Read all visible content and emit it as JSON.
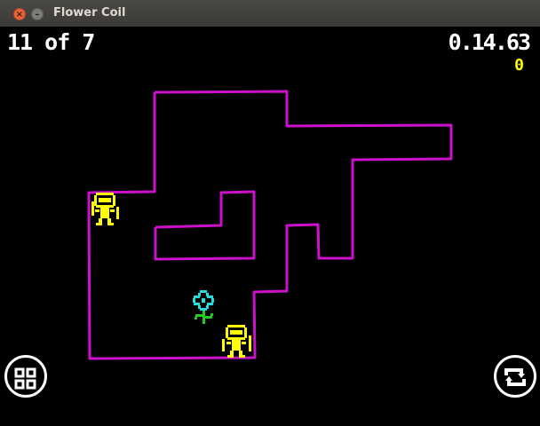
{
  "window": {
    "title": "Flower Coil"
  },
  "hud": {
    "level": "11 of 7",
    "timer": "0.14.63",
    "score": "0"
  },
  "colors": {
    "maze_wall": "#cc11cc",
    "player": "#ffff00",
    "flower_petals": "#22dddd",
    "flower_stem": "#22cc22",
    "background": "#000000"
  },
  "sprites": [
    {
      "name": "robot-character-1",
      "kind": "robot"
    },
    {
      "name": "robot-character-2",
      "kind": "robot"
    },
    {
      "name": "flower-goal",
      "kind": "flower"
    }
  ],
  "controls": {
    "menu_icon": "grid-icon",
    "restart_icon": "restart-icon"
  }
}
